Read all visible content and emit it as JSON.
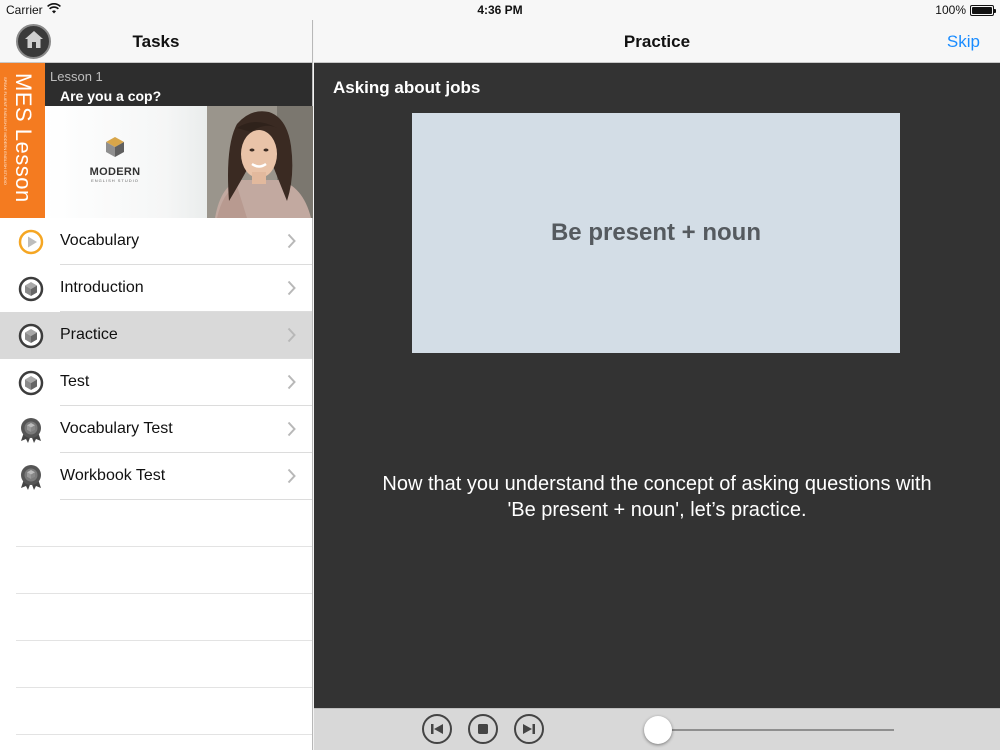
{
  "status_bar": {
    "carrier": "Carrier",
    "time": "4:36 PM",
    "battery": "100%",
    "battery_level": 1.0
  },
  "left_pane": {
    "title": "Tasks",
    "home_icon": "home-icon",
    "lesson": {
      "tab_label": "MES Lesson",
      "tab_tagline": "SPEAK FLUENT ENGLISH AT MODERN ENGLISH STUDIO",
      "number": "Lesson 1",
      "title": "Are you a cop?",
      "logo_name": "MODERN",
      "logo_sub": "ENGLISH STUDIO"
    },
    "tasks": [
      {
        "label": "Vocabulary",
        "icon": "play-circle-icon",
        "selected": false
      },
      {
        "label": "Introduction",
        "icon": "cube-icon",
        "selected": false
      },
      {
        "label": "Practice",
        "icon": "cube-icon",
        "selected": true
      },
      {
        "label": "Test",
        "icon": "cube-icon",
        "selected": false
      },
      {
        "label": "Vocabulary Test",
        "icon": "badge-icon",
        "selected": false
      },
      {
        "label": "Workbook Test",
        "icon": "badge-icon",
        "selected": false
      }
    ]
  },
  "right_pane": {
    "title": "Practice",
    "skip_label": "Skip",
    "section_heading": "Asking about jobs",
    "slide_text": "Be present + noun",
    "body_text": "Now that you understand the concept of asking questions with 'Be present + noun', let’s practice."
  },
  "player": {
    "controls": [
      "previous-icon",
      "stop-icon",
      "next-icon"
    ],
    "progress": 0.0
  },
  "colors": {
    "accent": "#1a8cff",
    "lesson_tab": "#f47b20",
    "content_bg": "#333333",
    "slide_bg": "#d3dde6",
    "vocab_icon": "#f5a623"
  }
}
